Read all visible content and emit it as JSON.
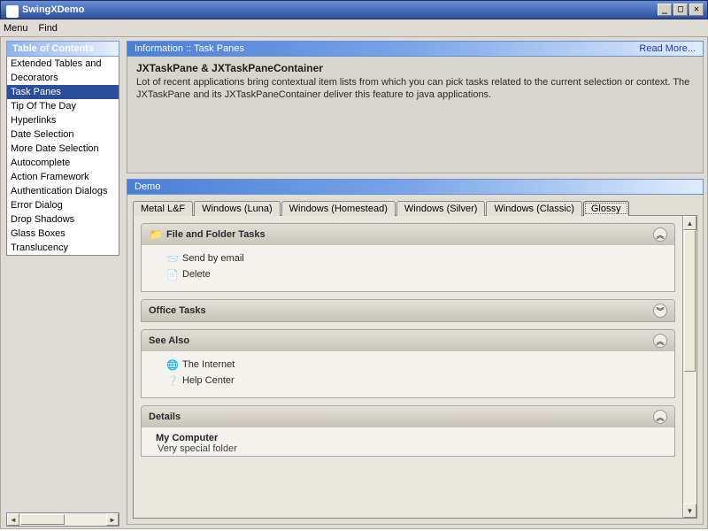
{
  "window": {
    "title": "SwingXDemo"
  },
  "menu": {
    "items": [
      "Menu",
      "Find"
    ]
  },
  "sidebar": {
    "header": "Table of Contents",
    "items": [
      "Extended Tables and",
      "Decorators",
      "Task Panes",
      "Tip Of The Day",
      "Hyperlinks",
      "Date Selection",
      "More Date Selection",
      "Autocomplete",
      "Action Framework",
      "Authentication Dialogs",
      "Error Dialog",
      "Drop Shadows",
      "Glass Boxes",
      "Translucency"
    ],
    "selected_index": 2
  },
  "info_panel": {
    "header": "Information :: Task Panes",
    "readmore": "Read More...",
    "title": "JXTaskPane & JXTaskPaneContainer",
    "description": "Lot of recent applications bring contextual item lists from which you can pick tasks related to the current selection or context. The JXTaskPane and its JXTaskPaneContainer deliver this feature to java applications."
  },
  "demo_panel": {
    "header": "Demo",
    "tabs": [
      "Metal L&F",
      "Windows (Luna)",
      "Windows (Homestead)",
      "Windows (Silver)",
      "Windows (Classic)",
      "Glossy"
    ],
    "active_tab_index": 5,
    "taskpanes": [
      {
        "title": "File and Folder Tasks",
        "expanded": true,
        "icon": "folder-icon",
        "items": [
          {
            "icon": "mail-icon",
            "label": "Send by email"
          },
          {
            "icon": "delete-icon",
            "label": "Delete"
          }
        ]
      },
      {
        "title": "Office Tasks",
        "expanded": false
      },
      {
        "title": "See Also",
        "expanded": true,
        "items": [
          {
            "icon": "globe-icon",
            "label": "The Internet"
          },
          {
            "icon": "help-icon",
            "label": "Help Center"
          }
        ]
      },
      {
        "title": "Details",
        "expanded": true,
        "details": {
          "heading": "My Computer",
          "sub": "Very special folder"
        }
      }
    ]
  }
}
